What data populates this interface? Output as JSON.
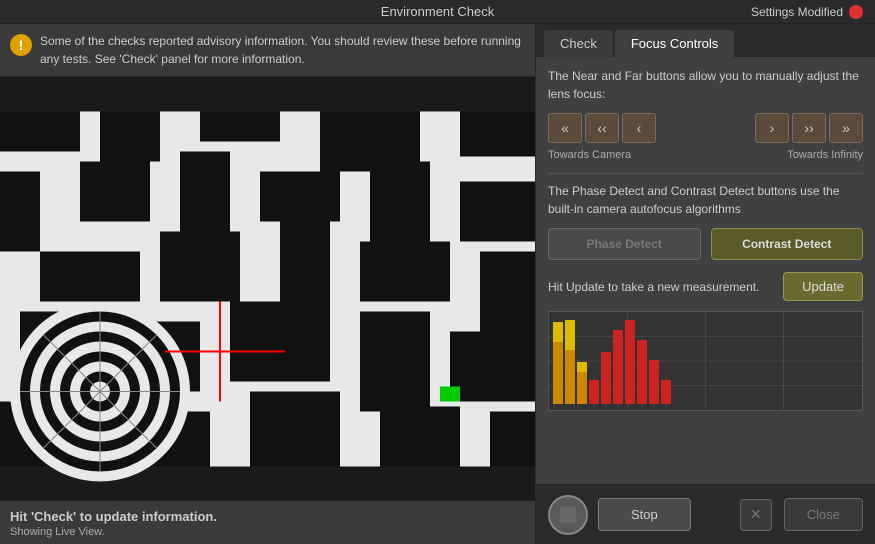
{
  "titleBar": {
    "title": "Environment Check",
    "settingsLabel": "Settings Modified"
  },
  "advisory": {
    "text": "Some of the checks reported advisory information.  You should review these before running any tests.  See 'Check' panel for more information."
  },
  "tabs": [
    {
      "id": "check",
      "label": "Check"
    },
    {
      "id": "focus",
      "label": "Focus Controls"
    }
  ],
  "focusControls": {
    "description": "The Near and Far buttons allow you to manually adjust the lens focus:",
    "buttons": {
      "farFarLeft": "«",
      "farLeft": "‹‹",
      "left": "‹",
      "right": "›",
      "farRight": "››",
      "farFarRight": "»"
    },
    "labels": {
      "towardsCamera": "Towards Camera",
      "towardsInfinity": "Towards Infinity"
    },
    "afDescription": "The Phase Detect and Contrast Detect buttons use the built-in camera autofocus algorithms",
    "phaseDetectLabel": "Phase Detect",
    "contrastDetectLabel": "Contrast Detect",
    "updateDescription": "Hit Update to take a new measurement.",
    "updateLabel": "Update"
  },
  "bottomBar": {
    "stopLabel": "Stop",
    "closeLabel": "Close"
  },
  "leftBottom": {
    "hintText": "Hit 'Check' to update information.",
    "subText": "Showing Live View."
  },
  "histogram": {
    "bars": [
      {
        "orange": 60,
        "yellow": 20
      },
      {
        "orange": 50,
        "yellow": 30
      },
      {
        "orange": 20,
        "yellow": 10
      },
      {
        "red": 30
      },
      {
        "red": 60
      },
      {
        "red": 80
      },
      {
        "red": 90
      },
      {
        "red": 70
      },
      {
        "red": 40
      },
      {
        "red": 20
      },
      {},
      {},
      {},
      {},
      {},
      {},
      {},
      {},
      {},
      {}
    ]
  }
}
